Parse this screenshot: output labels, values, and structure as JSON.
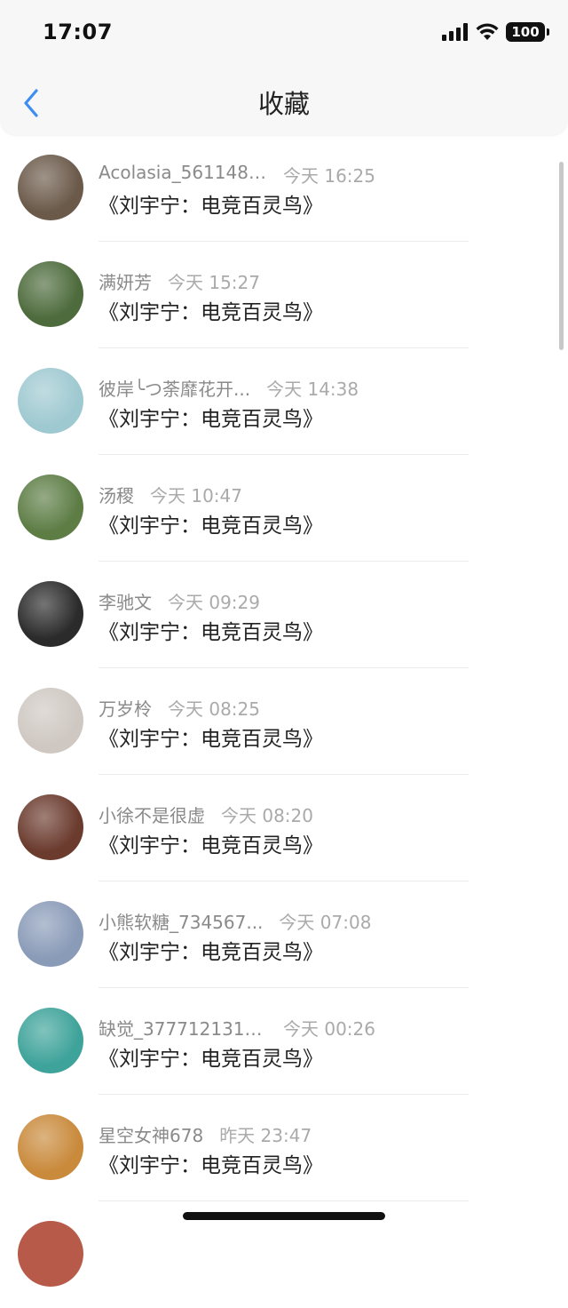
{
  "status": {
    "time": "17:07",
    "battery": "100"
  },
  "nav": {
    "title": "收藏"
  },
  "items": [
    {
      "name": "Acolasia_5611481...",
      "time": "今天 16:25",
      "content": "《刘宇宁：电竞百灵鸟》",
      "avatar_color": "#6b5a4a"
    },
    {
      "name": "满妍芳",
      "time": "今天 15:27",
      "content": "《刘宇宁：电竞百灵鸟》",
      "avatar_color": "#4d6b3c"
    },
    {
      "name": "彼岸╰つ荼靡花开...",
      "time": "今天 14:38",
      "content": "《刘宇宁：电竞百灵鸟》",
      "avatar_color": "#9fc9d1"
    },
    {
      "name": "汤稷",
      "time": "今天 10:47",
      "content": "《刘宇宁：电竞百灵鸟》",
      "avatar_color": "#5d7d45"
    },
    {
      "name": "李驰文",
      "time": "今天 09:29",
      "content": "《刘宇宁：电竞百灵鸟》",
      "avatar_color": "#2b2b2b"
    },
    {
      "name": "万岁柃",
      "time": "今天 08:25",
      "content": "《刘宇宁：电竞百灵鸟》",
      "avatar_color": "#cfc8c2"
    },
    {
      "name": "小徐不是很虚",
      "time": "今天 08:20",
      "content": "《刘宇宁：电竞百灵鸟》",
      "avatar_color": "#6b3b2e"
    },
    {
      "name": "小熊软糖_734567...",
      "time": "今天 07:08",
      "content": "《刘宇宁：电竞百灵鸟》",
      "avatar_color": "#8a9bb8"
    },
    {
      "name": "缺觉_3777121314...",
      "time": "今天 00:26",
      "content": "《刘宇宁：电竞百灵鸟》",
      "avatar_color": "#3ea39a"
    },
    {
      "name": "星空女神678",
      "time": "昨天 23:47",
      "content": "《刘宇宁：电竞百灵鸟》",
      "avatar_color": "#c98a3c"
    }
  ]
}
